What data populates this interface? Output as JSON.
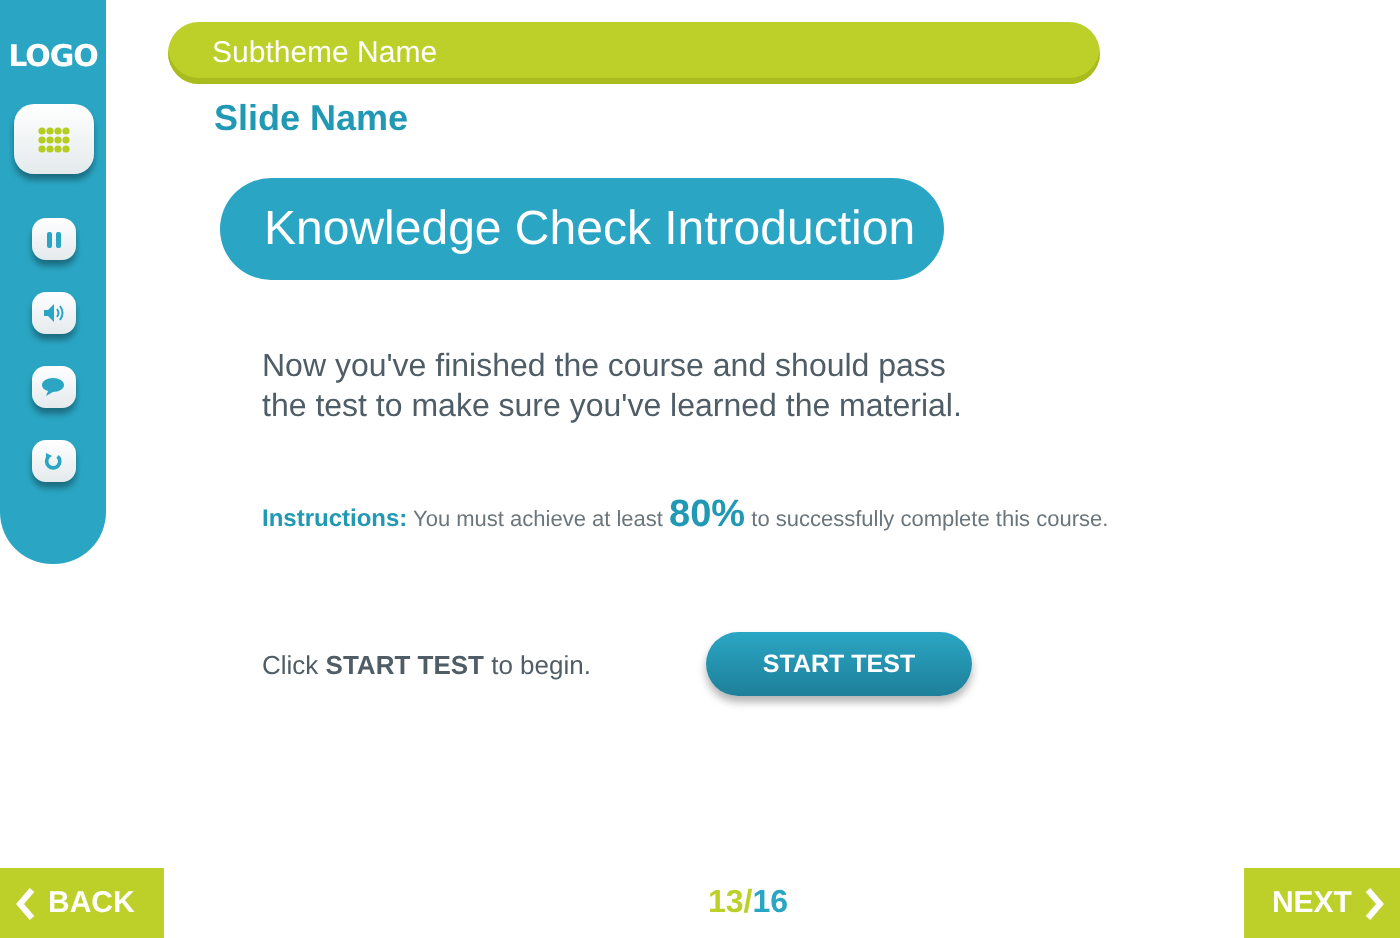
{
  "sidebar": {
    "logo": "LOGO"
  },
  "header": {
    "subtheme": "Subtheme Name",
    "slide_name": "Slide Name"
  },
  "title": "Knowledge Check Introduction",
  "intro": "Now you've finished the course and should pass\nthe test to make sure you've learned the material.",
  "instructions": [
    {
      "kind": "label",
      "text": "Instructions:"
    },
    {
      "kind": "plain",
      "text": " You must achieve at least "
    },
    {
      "kind": "emphasis",
      "text": "80%"
    },
    {
      "kind": "plain",
      "text": " to successfully complete this course."
    }
  ],
  "prompt": "Click **START TEST** to begin.",
  "start_button": "START TEST",
  "footer": {
    "back": "BACK",
    "next": "NEXT",
    "page": {
      "current": "13",
      "separator": "/",
      "total": "16"
    }
  }
}
